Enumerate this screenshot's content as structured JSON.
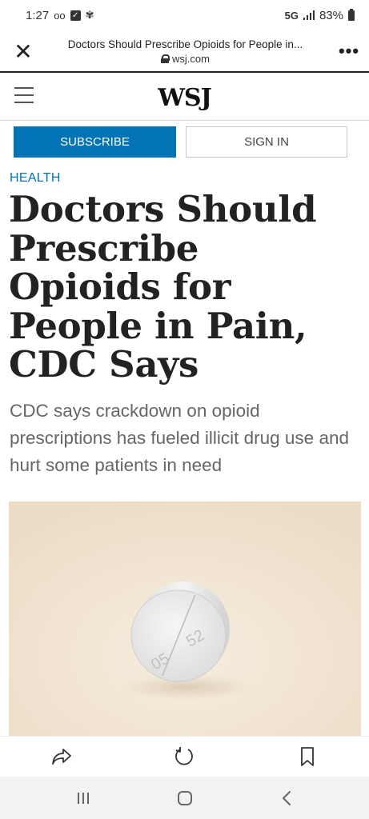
{
  "status_bar": {
    "time": "1:27",
    "voicemail_glyph": "oo",
    "network": "5G",
    "battery": "83%"
  },
  "browser": {
    "page_title": "Doctors Should Prescribe Opioids for People in...",
    "domain": "wsj.com",
    "close_glyph": "✕",
    "more_glyph": "•••"
  },
  "site": {
    "logo": "WSJ",
    "subscribe_label": "SUBSCRIBE",
    "signin_label": "SIGN IN"
  },
  "article": {
    "section": "HEALTH",
    "headline": "Doctors Should Prescribe Opioids for People in Pain, CDC Says",
    "dek": "CDC says crackdown on opioid prescriptions has fueled illicit drug use and hurt some patients in need",
    "pill_imprint_left": "05",
    "pill_imprint_right": "52"
  },
  "colors": {
    "accent": "#0274b6",
    "headline": "#222222",
    "dek": "#666666",
    "nav_background": "#f2f2f2"
  },
  "icons": {
    "share": "share-icon",
    "refresh": "refresh-icon",
    "bookmark": "bookmark-icon",
    "recents": "recents-icon",
    "home": "home-icon",
    "back": "back-icon"
  }
}
